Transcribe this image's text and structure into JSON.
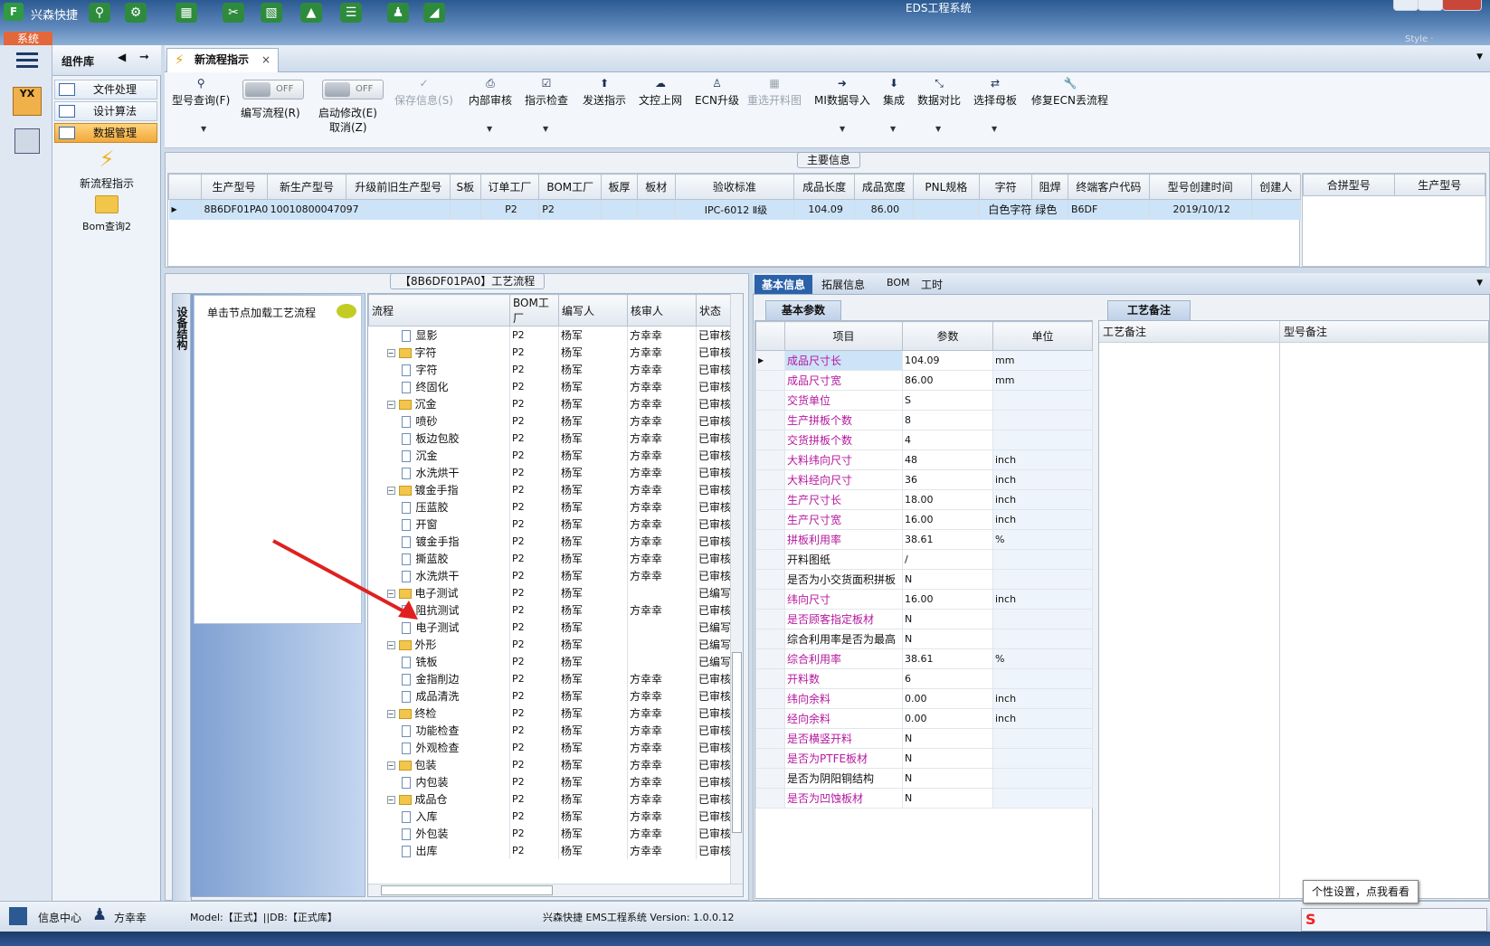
{
  "window": {
    "app_name": "兴森快捷",
    "title": "EDS工程系统",
    "style_label": "Style ·"
  },
  "system_button": "系统",
  "component_library": {
    "title": "组件库",
    "items": [
      {
        "label": "文件处理",
        "active": false
      },
      {
        "label": "设计算法",
        "active": false
      },
      {
        "label": "数据管理",
        "active": true
      }
    ],
    "big_items": [
      {
        "label": "新流程指示",
        "icon": "lightning-icon"
      },
      {
        "label": "Bom查询2",
        "icon": "folder-icon"
      }
    ]
  },
  "main_tab": {
    "label": "新流程指示",
    "close": "×"
  },
  "ribbon": {
    "model_query": "型号查询(F)",
    "toggle1_state": "OFF",
    "toggle1_label": "编写流程(R)",
    "toggle2_state": "OFF",
    "toggle2_label": "启动修改(E)",
    "toggle2_sub": "取消(Z)",
    "save_info": "保存信息(S)",
    "internal_review": "内部审核",
    "instruction_check": "指示检查",
    "send_instruction": "发送指示",
    "upload": "文控上网",
    "ecn_upgrade": "ECN升级",
    "reselect_drawing": "重选开料图",
    "mi_import": "MI数据导入",
    "integrate": "集成",
    "compare": "数据对比",
    "select_master": "选择母板",
    "fix_ecn": "修复ECN丢流程"
  },
  "main_info": {
    "title": "主要信息",
    "columns": [
      "生产型号",
      "新生产型号",
      "升级前旧生产型号",
      "S板",
      "订单工厂",
      "BOM工厂",
      "板厚",
      "板材",
      "验收标准",
      "成品长度",
      "成品宽度",
      "PNL规格",
      "字符",
      "阻焊",
      "终端客户代码",
      "型号创建时间",
      "创建人"
    ],
    "row": [
      "8B6DF01PA0",
      "10010800047097",
      "",
      "",
      "P2",
      "P2",
      "",
      "",
      "IPC-6012 Ⅱ级",
      "104.09",
      "86.00",
      "",
      "白色字符",
      "绿色",
      "B6DF",
      "2019/10/12",
      ""
    ],
    "right_columns": [
      "合拼型号",
      "生产型号"
    ]
  },
  "flow_panel": {
    "title": "【8B6DF01PA0】工艺流程",
    "side_tab": "设备结构",
    "load_hint": "单击节点加载工艺流程",
    "columns": [
      "流程",
      "BOM工厂",
      "编写人",
      "核审人",
      "状态"
    ],
    "rows": [
      {
        "name": "显影",
        "level": 2,
        "factory": "P2",
        "writer": "杨军",
        "reviewer": "方幸幸",
        "status": "已审核"
      },
      {
        "name": "字符",
        "level": 1,
        "factory": "P2",
        "writer": "杨军",
        "reviewer": "方幸幸",
        "status": "已审核"
      },
      {
        "name": "字符",
        "level": 2,
        "factory": "P2",
        "writer": "杨军",
        "reviewer": "方幸幸",
        "status": "已审核"
      },
      {
        "name": "终固化",
        "level": 2,
        "factory": "P2",
        "writer": "杨军",
        "reviewer": "方幸幸",
        "status": "已审核"
      },
      {
        "name": "沉金",
        "level": 1,
        "factory": "P2",
        "writer": "杨军",
        "reviewer": "方幸幸",
        "status": "已审核"
      },
      {
        "name": "喷砂",
        "level": 2,
        "factory": "P2",
        "writer": "杨军",
        "reviewer": "方幸幸",
        "status": "已审核"
      },
      {
        "name": "板边包胶",
        "level": 2,
        "factory": "P2",
        "writer": "杨军",
        "reviewer": "方幸幸",
        "status": "已审核"
      },
      {
        "name": "沉金",
        "level": 2,
        "factory": "P2",
        "writer": "杨军",
        "reviewer": "方幸幸",
        "status": "已审核"
      },
      {
        "name": "水洗烘干",
        "level": 2,
        "factory": "P2",
        "writer": "杨军",
        "reviewer": "方幸幸",
        "status": "已审核"
      },
      {
        "name": "镀金手指",
        "level": 1,
        "factory": "P2",
        "writer": "杨军",
        "reviewer": "方幸幸",
        "status": "已审核"
      },
      {
        "name": "压蓝胶",
        "level": 2,
        "factory": "P2",
        "writer": "杨军",
        "reviewer": "方幸幸",
        "status": "已审核"
      },
      {
        "name": "开窗",
        "level": 2,
        "factory": "P2",
        "writer": "杨军",
        "reviewer": "方幸幸",
        "status": "已审核"
      },
      {
        "name": "镀金手指",
        "level": 2,
        "factory": "P2",
        "writer": "杨军",
        "reviewer": "方幸幸",
        "status": "已审核"
      },
      {
        "name": "撕蓝胶",
        "level": 2,
        "factory": "P2",
        "writer": "杨军",
        "reviewer": "方幸幸",
        "status": "已审核"
      },
      {
        "name": "水洗烘干",
        "level": 2,
        "factory": "P2",
        "writer": "杨军",
        "reviewer": "方幸幸",
        "status": "已审核"
      },
      {
        "name": "电子测试",
        "level": 1,
        "factory": "P2",
        "writer": "杨军",
        "reviewer": "",
        "status": "已编写"
      },
      {
        "name": "阻抗测试",
        "level": 2,
        "factory": "P2",
        "writer": "杨军",
        "reviewer": "方幸幸",
        "status": "已审核"
      },
      {
        "name": "电子测试",
        "level": 2,
        "factory": "P2",
        "writer": "杨军",
        "reviewer": "",
        "status": "已编写"
      },
      {
        "name": "外形",
        "level": 1,
        "factory": "P2",
        "writer": "杨军",
        "reviewer": "",
        "status": "已编写"
      },
      {
        "name": "铣板",
        "level": 2,
        "factory": "P2",
        "writer": "杨军",
        "reviewer": "",
        "status": "已编写"
      },
      {
        "name": "金指削边",
        "level": 2,
        "factory": "P2",
        "writer": "杨军",
        "reviewer": "方幸幸",
        "status": "已审核"
      },
      {
        "name": "成品清洗",
        "level": 2,
        "factory": "P2",
        "writer": "杨军",
        "reviewer": "方幸幸",
        "status": "已审核"
      },
      {
        "name": "终检",
        "level": 1,
        "factory": "P2",
        "writer": "杨军",
        "reviewer": "方幸幸",
        "status": "已审核"
      },
      {
        "name": "功能检查",
        "level": 2,
        "factory": "P2",
        "writer": "杨军",
        "reviewer": "方幸幸",
        "status": "已审核"
      },
      {
        "name": "外观检查",
        "level": 2,
        "factory": "P2",
        "writer": "杨军",
        "reviewer": "方幸幸",
        "status": "已审核"
      },
      {
        "name": "包装",
        "level": 1,
        "factory": "P2",
        "writer": "杨军",
        "reviewer": "方幸幸",
        "status": "已审核"
      },
      {
        "name": "内包装",
        "level": 2,
        "factory": "P2",
        "writer": "杨军",
        "reviewer": "方幸幸",
        "status": "已审核"
      },
      {
        "name": "成品仓",
        "level": 1,
        "factory": "P2",
        "writer": "杨军",
        "reviewer": "方幸幸",
        "status": "已审核"
      },
      {
        "name": "入库",
        "level": 2,
        "factory": "P2",
        "writer": "杨军",
        "reviewer": "方幸幸",
        "status": "已审核"
      },
      {
        "name": "外包装",
        "level": 2,
        "factory": "P2",
        "writer": "杨军",
        "reviewer": "方幸幸",
        "status": "已审核"
      },
      {
        "name": "出库",
        "level": 2,
        "factory": "P2",
        "writer": "杨军",
        "reviewer": "方幸幸",
        "status": "已审核"
      }
    ]
  },
  "info_tabs": [
    "基本信息",
    "拓展信息",
    "BOM",
    "工时"
  ],
  "basic_params": {
    "title": "基本参数",
    "columns": [
      "项目",
      "参数",
      "单位"
    ],
    "rows": [
      {
        "item": "成品尺寸长",
        "value": "104.09",
        "unit": "mm",
        "highlight": true
      },
      {
        "item": "成品尺寸宽",
        "value": "86.00",
        "unit": "mm",
        "highlight": true
      },
      {
        "item": "交货单位",
        "value": "S",
        "unit": "",
        "highlight": true
      },
      {
        "item": "生产拼板个数",
        "value": "8",
        "unit": "",
        "highlight": true
      },
      {
        "item": "交货拼板个数",
        "value": "4",
        "unit": "",
        "highlight": true
      },
      {
        "item": "大料纬向尺寸",
        "value": "48",
        "unit": "inch",
        "highlight": true
      },
      {
        "item": "大料经向尺寸",
        "value": "36",
        "unit": "inch",
        "highlight": true
      },
      {
        "item": "生产尺寸长",
        "value": "18.00",
        "unit": "inch",
        "highlight": true
      },
      {
        "item": "生产尺寸宽",
        "value": "16.00",
        "unit": "inch",
        "highlight": true
      },
      {
        "item": "拼板利用率",
        "value": "38.61",
        "unit": "%",
        "highlight": true
      },
      {
        "item": "开料图纸",
        "value": "/",
        "unit": "",
        "highlight": false
      },
      {
        "item": "是否为小交货面积拼板",
        "value": "N",
        "unit": "",
        "highlight": false
      },
      {
        "item": "纬向尺寸",
        "value": "16.00",
        "unit": "inch",
        "highlight": true
      },
      {
        "item": "是否顾客指定板材",
        "value": "N",
        "unit": "",
        "highlight": true
      },
      {
        "item": "综合利用率是否为最高",
        "value": "N",
        "unit": "",
        "highlight": false
      },
      {
        "item": "综合利用率",
        "value": "38.61",
        "unit": "%",
        "highlight": true
      },
      {
        "item": "开料数",
        "value": "6",
        "unit": "",
        "highlight": true
      },
      {
        "item": "纬向余料",
        "value": "0.00",
        "unit": "inch",
        "highlight": true
      },
      {
        "item": "经向余料",
        "value": "0.00",
        "unit": "inch",
        "highlight": true
      },
      {
        "item": "是否横竖开料",
        "value": "N",
        "unit": "",
        "highlight": true
      },
      {
        "item": "是否为PTFE板材",
        "value": "N",
        "unit": "",
        "highlight": true
      },
      {
        "item": "是否为阴阳铜结构",
        "value": "N",
        "unit": "",
        "highlight": false
      },
      {
        "item": "是否为凹蚀板材",
        "value": "N",
        "unit": "",
        "highlight": true
      }
    ]
  },
  "process_remark": {
    "title": "工艺备注",
    "col1": "工艺备注",
    "col2": "型号备注"
  },
  "statusbar": {
    "info_center": "信息中心",
    "user": "方幸幸",
    "model": "Model:【正式】||DB:【正式库】",
    "version": "兴森快捷 EMS工程系统 Version: 1.0.0.12"
  },
  "tooltip": "个性设置，点我看看",
  "colors": {
    "highlight_label": "#b5179e",
    "accent_blue": "#2b61a8",
    "active_orange": "#f1a83a"
  }
}
